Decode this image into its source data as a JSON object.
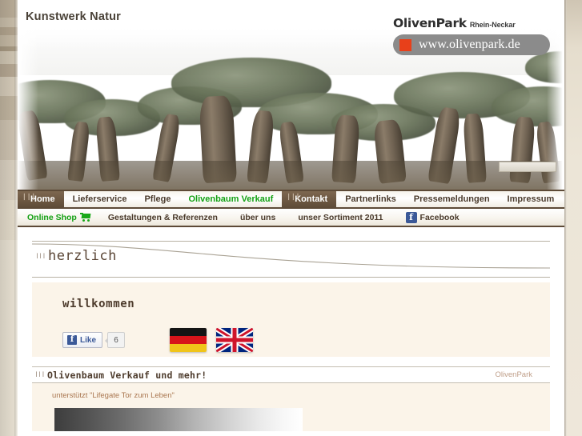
{
  "site": {
    "title": "Kunstwerk Natur"
  },
  "logo": {
    "wordmark": "OlivenPark",
    "region": "Rhein-Neckar",
    "url": "www.olivenpark.de",
    "square_color": "#e8401a",
    "pill_color": "#8b8b8b"
  },
  "nav_primary": {
    "items": [
      {
        "label": "Home",
        "state": "active",
        "icon": "tick-marks"
      },
      {
        "label": "Lieferservice",
        "state": "normal"
      },
      {
        "label": "Pflege",
        "state": "normal"
      },
      {
        "label": "Olivenbaum Verkauf",
        "state": "highlight"
      },
      {
        "label": "Kontakt",
        "state": "active",
        "icon": "tick-marks"
      },
      {
        "label": "Partnerlinks",
        "state": "normal"
      },
      {
        "label": "Pressemeldungen",
        "state": "normal"
      },
      {
        "label": "Impressum",
        "state": "normal"
      }
    ],
    "active_color": "#6d5842",
    "highlight_color": "#12a012"
  },
  "nav_secondary": {
    "items": [
      {
        "label": "Online Shop",
        "icon": "shopping-cart-icon",
        "state": "shop"
      },
      {
        "label": "Gestaltungen & Referenzen",
        "state": "normal"
      },
      {
        "label": "über uns",
        "state": "normal"
      },
      {
        "label": "unser Sortiment 2011",
        "state": "normal"
      },
      {
        "label": "Facebook",
        "icon": "facebook-icon",
        "state": "normal"
      }
    ]
  },
  "herzlich": {
    "marks": "❘❘❘",
    "title": "herzlich"
  },
  "welcome": {
    "title": "willkommen",
    "facebook": {
      "like_label": "Like",
      "icon_letter": "f",
      "count": "6"
    },
    "flags": [
      {
        "name": "german-flag",
        "label": "Deutsch"
      },
      {
        "name": "british-flag",
        "label": "English"
      }
    ]
  },
  "oliven_section": {
    "marks": "❘❘❘",
    "title": "Olivenbaum Verkauf und mehr!",
    "byline": "OlivenPark",
    "support_text": "unterstützt \"Lifegate Tor zum Leben\""
  },
  "header_slider": {
    "name": "image-slider-control"
  }
}
